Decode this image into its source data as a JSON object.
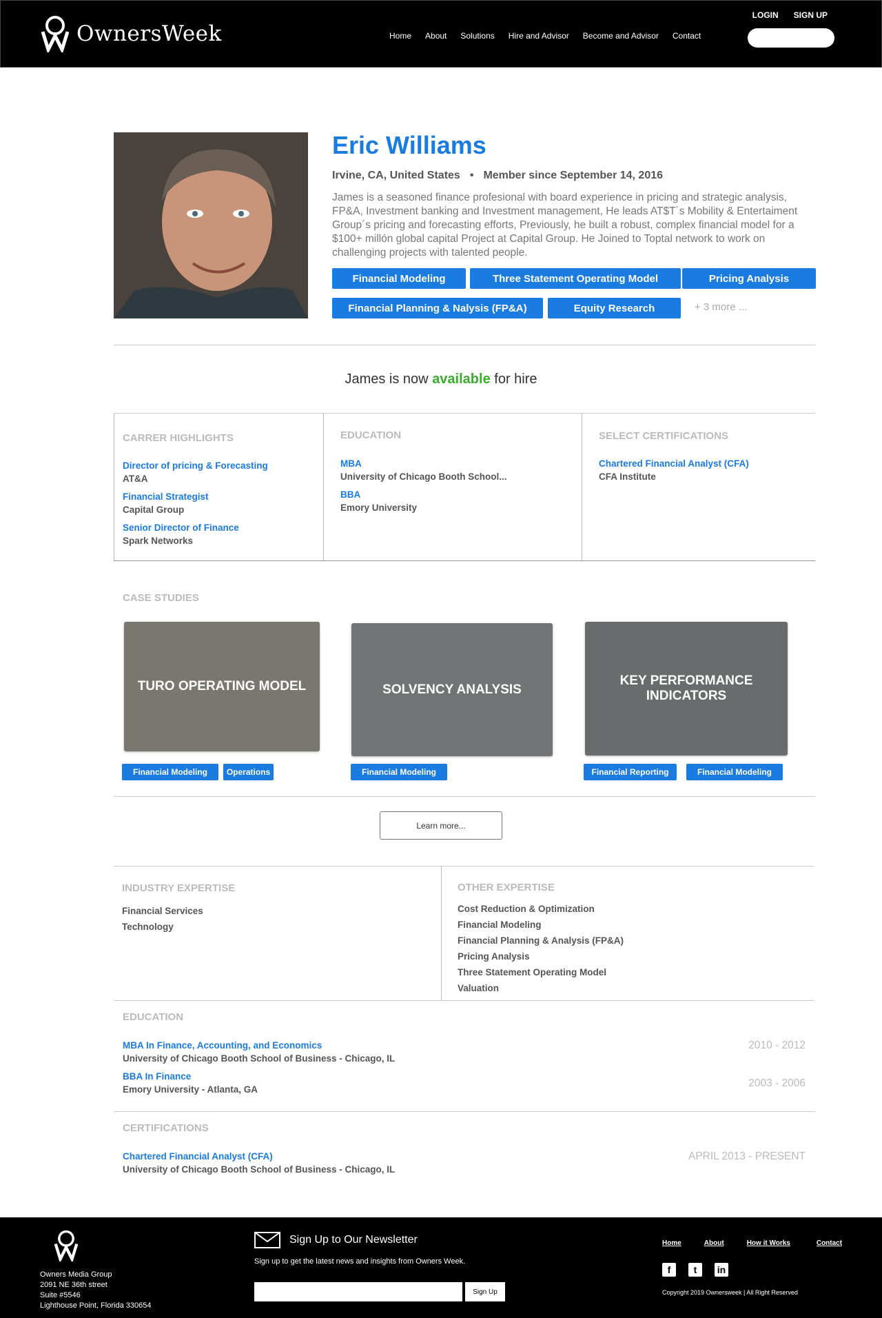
{
  "header": {
    "brand": "OwnersWeek",
    "login": "LOGIN",
    "signup": "SIGN UP",
    "nav": [
      "Home",
      "About",
      "Solutions",
      "Hire and Advisor",
      "Become and Advisor",
      "Contact"
    ],
    "search_placeholder": ""
  },
  "profile": {
    "name": "Eric Williams",
    "location": "Irvine, CA, United States",
    "separator": "•",
    "member_since": "Member since September 14, 2016",
    "bio": "James is a seasoned finance profesional with board experience in pricing and strategic analysis, FP&A, Investment banking and Investment management, He leads AT$T´s Mobility & Entertaiment Group´s pricing and forecasting efforts, Previously, he built a robust, complex financial model for a $100+ millón global capital Project at Capital Group. He Joined to Toptal network to work on challenging projects with talented people.",
    "tags": [
      "Financial Modeling",
      "Three Statement Operating Model",
      "Pricing Analysis",
      "Financial Planning & Nalysis (FP&A)",
      "Equity Research"
    ],
    "more": "+ 3 more ..."
  },
  "availability": {
    "prefix": "James is now",
    "status": "available",
    "suffix": "for hire",
    "status_color": "#3aae2a"
  },
  "highlights": {
    "career_title": "CARRER HIGHLIGHTS",
    "career": [
      {
        "role": "Director of pricing & Forecasting",
        "org": "AT&A"
      },
      {
        "role": "Financial Strategist",
        "org": "Capital Group"
      },
      {
        "role": "Senior Director of Finance",
        "org": "Spark Networks"
      }
    ],
    "education_title": "EDUCATION",
    "education": [
      {
        "degree": "MBA",
        "school": "University of Chicago Booth School..."
      },
      {
        "degree": "BBA",
        "school": "Emory University"
      }
    ],
    "cert_title": "SELECT CERTIFICATIONS",
    "certs": [
      {
        "name": "Chartered Financial Analyst (CFA)",
        "issuer": "CFA Institute"
      }
    ]
  },
  "case_studies": {
    "title": "CASE STUDIES",
    "items": [
      {
        "title": "TURO OPERATING MODEL",
        "tags": [
          "Financial Modeling",
          "Operations"
        ]
      },
      {
        "title": "SOLVENCY ANALYSIS",
        "tags": [
          "Financial Modeling"
        ]
      },
      {
        "title": "KEY PERFORMANCE INDICATORS",
        "tags": [
          "Financial Reporting",
          "Financial Modeling"
        ]
      }
    ],
    "learn_more": "Learn more..."
  },
  "expertise": {
    "industry_title": "INDUSTRY EXPERTISE",
    "industry": [
      "Financial Services",
      "Technology"
    ],
    "other_title": "OTHER EXPERTISE",
    "other": [
      "Cost Reduction & Optimization",
      "Financial Modeling",
      "Financial Planning & Analysis (FP&A)",
      "Pricing Analysis",
      "Three Statement Operating Model",
      "Valuation"
    ]
  },
  "education": {
    "title": "EDUCATION",
    "items": [
      {
        "degree": "MBA In Finance, Accounting, and Economics",
        "school": "University of Chicago Booth School of Business - Chicago, IL",
        "years": "2010 - 2012"
      },
      {
        "degree": "BBA In Finance",
        "school": "Emory University - Atlanta, GA",
        "years": "2003 - 2006"
      }
    ]
  },
  "certifications": {
    "title": "CERTIFICATIONS",
    "items": [
      {
        "name": "Chartered Financial Analyst (CFA)",
        "school": "University of Chicago Booth School of Business - Chicago, IL",
        "years": "APRIL 2013 - PRESENT"
      }
    ]
  },
  "footer": {
    "address": [
      "Owners Media Group",
      "2091 NE 36th street",
      "Suite #5546",
      "Lighthouse Point, Florida 330654"
    ],
    "newsletter_title": "Sign Up to Our Newsletter",
    "newsletter_sub": "Sign up to get the latest news and insights from Owners Week.",
    "newsletter_btn": "Sign Up",
    "links": [
      "Home",
      "About",
      "How it Works",
      "Contact"
    ],
    "social": [
      "facebook-icon",
      "twitter-icon",
      "linkedin-icon"
    ],
    "copyright": "Copyright 2019 Ownersweek | All Right Reserved"
  },
  "colors": {
    "accent": "#1a7be0",
    "available": "#3aae2a",
    "header_bg": "#000000"
  }
}
